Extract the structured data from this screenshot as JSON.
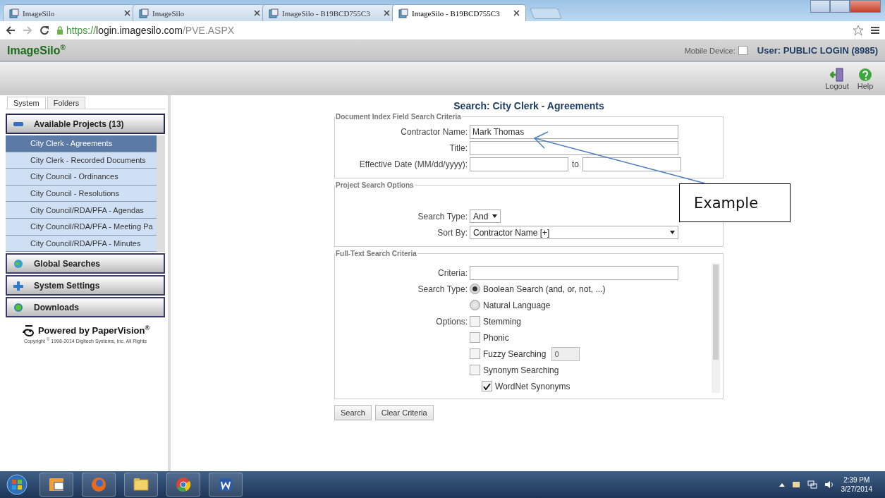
{
  "browser": {
    "tabs": [
      {
        "title": "ImageSilo",
        "selected": false
      },
      {
        "title": "ImageSilo",
        "selected": false
      },
      {
        "title": "ImageSilo - B19BCD755C3",
        "selected": false
      },
      {
        "title": "ImageSilo - B19BCD755C3",
        "selected": true
      }
    ],
    "url": {
      "scheme": "https://",
      "host": "login.imagesilo.com",
      "path": "/PVE.ASPX"
    }
  },
  "header": {
    "brand": "ImageSilo$^{®}$",
    "mobile_label": "Mobile Device:",
    "mobile_checked": false,
    "user": "User: PUBLIC LOGIN (8985)"
  },
  "toolbar": [
    {
      "kind": "logout",
      "label": "Logout"
    },
    {
      "kind": "help",
      "label": "Help"
    }
  ],
  "sidebar": {
    "tabs": [
      {
        "label": "System",
        "selected": true
      },
      {
        "label": "Folders",
        "selected": false
      }
    ],
    "panels": [
      {
        "kind": "minus",
        "title": "Available Projects (13)",
        "expanded": true,
        "items": [
          {
            "label": "City Clerk - Agreements",
            "selected": true
          },
          {
            "label": "City Clerk - Recorded Documents",
            "selected": false
          },
          {
            "label": "City Council - Ordinances",
            "selected": false
          },
          {
            "label": "City Council - Resolutions",
            "selected": false
          },
          {
            "label": "City Council/RDA/PFA - Agendas",
            "selected": false
          },
          {
            "label": "City Council/RDA/PFA - Meeting Pa",
            "selected": false
          },
          {
            "label": "City Council/RDA/PFA - Minutes",
            "selected": false
          }
        ]
      },
      {
        "kind": "globe",
        "title": "Global Searches",
        "expanded": false
      },
      {
        "kind": "plus",
        "title": "System Settings",
        "expanded": false
      },
      {
        "kind": "dot",
        "title": "Downloads",
        "expanded": false
      }
    ],
    "powered": "Powered by PaperVision$^{®}$",
    "copyright": "Copyright $^{©}$ 1998-2014 Digitech Systems, Inc. All Rights"
  },
  "search": {
    "title": "Search: City Clerk - Agreements",
    "index_section": {
      "legend": "Document Index Field Search Criteria",
      "fields": [
        {
          "kind": "text",
          "label": "Contractor Name:",
          "value": "Mark Thomas"
        },
        {
          "kind": "text",
          "label": "Title:"
        },
        {
          "kind": "range",
          "label": "Effective Date (MM/dd/yyyy):",
          "separator": "to"
        }
      ]
    },
    "options_section": {
      "legend": "Project Search Options",
      "fields": [
        {
          "kind": "short_select",
          "label": "Search Type:",
          "value": "And"
        },
        {
          "kind": "wide_select",
          "label": "Sort By:",
          "value": "Contractor Name [+]"
        }
      ]
    },
    "fulltext_section": {
      "legend": "Full-Text Search Criteria",
      "criteria_label": "Criteria:",
      "search_type_label": "Search Type:",
      "search_types": [
        {
          "label": "Boolean Search (and, or, not, ...)",
          "selected": true
        },
        {
          "label": "Natural Language",
          "selected": false
        }
      ],
      "options_label": "Options:",
      "options": [
        {
          "label": "Stemming",
          "checked": false,
          "nested": false
        },
        {
          "label": "Phonic",
          "checked": false,
          "nested": false
        },
        {
          "label": "Fuzzy Searching",
          "checked": false,
          "nested": false,
          "value": "0"
        },
        {
          "label": "Synonym Searching",
          "checked": false,
          "nested": false
        },
        {
          "label": "WordNet Synonyms",
          "checked": true,
          "nested": true
        }
      ]
    },
    "buttons": [
      "Search",
      "Clear Criteria"
    ]
  },
  "callout": "Example",
  "taskbar": {
    "apps": [
      {
        "kind": "outlook"
      },
      {
        "kind": "firefox"
      },
      {
        "kind": "folder"
      },
      {
        "kind": "chrome"
      },
      {
        "kind": "word"
      }
    ],
    "time": "2:39 PM",
    "date": "3/27/2014"
  }
}
